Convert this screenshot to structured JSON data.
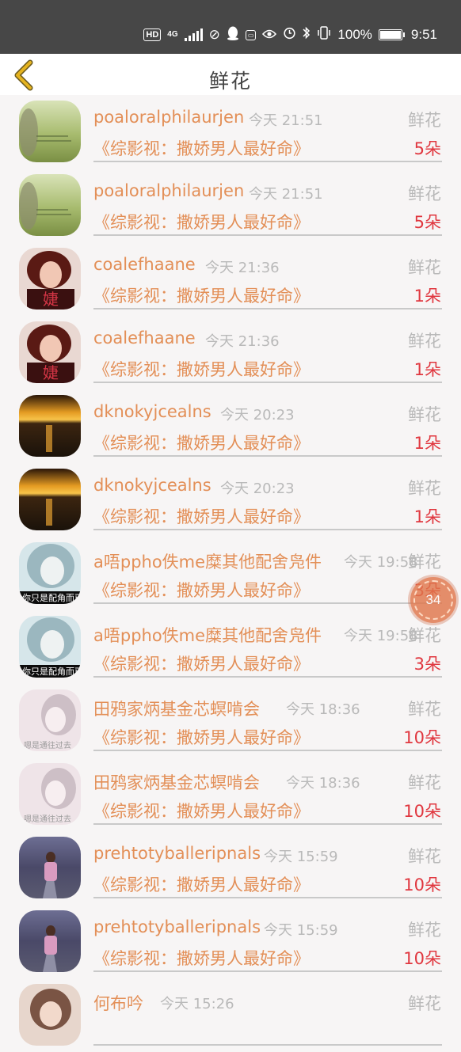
{
  "status_bar": {
    "hd": "HD",
    "network": "4G",
    "battery_pct": "100%",
    "time": "9:51",
    "icons": [
      "hd-icon",
      "signal-icon",
      "no-disturb-icon",
      "qq-icon",
      "huawei-icon",
      "eye-icon",
      "alarm-icon",
      "bluetooth-icon",
      "vibrate-icon",
      "battery-icon"
    ]
  },
  "header": {
    "title": "鲜花",
    "back_icon": "chevron-left-icon"
  },
  "gift_list": [
    {
      "name": "poaloralphilaurjen",
      "time": "今天 21:51",
      "type": "鲜花",
      "book": "《综影视：撒娇男人最好命》",
      "count": "5朵",
      "avatar_theme": "green-field"
    },
    {
      "name": "poaloralphilaurjen",
      "time": "今天 21:51",
      "type": "鲜花",
      "book": "《综影视：撒娇男人最好命》",
      "count": "5朵",
      "avatar_theme": "green-field"
    },
    {
      "name": "coalefhaane",
      "time": "今天 21:36",
      "type": "鲜花",
      "book": "《综影视：撒娇男人最好命》",
      "count": "1朵",
      "avatar_theme": "red-girl"
    },
    {
      "name": "coalefhaane",
      "time": "今天 21:36",
      "type": "鲜花",
      "book": "《综影视：撒娇男人最好命》",
      "count": "1朵",
      "avatar_theme": "red-girl"
    },
    {
      "name": "dknokyjcealns",
      "time": "今天 20:23",
      "type": "鲜花",
      "book": "《综影视：撒娇男人最好命》",
      "count": "1朵",
      "avatar_theme": "sunset-sea"
    },
    {
      "name": "dknokyjcealns",
      "time": "今天 20:23",
      "type": "鲜花",
      "book": "《综影视：撒娇男人最好命》",
      "count": "1朵",
      "avatar_theme": "sunset-sea"
    },
    {
      "name": "a唔ppho佚me糜其他配舍凫件",
      "time": "今天 19:58",
      "type": "鲜花",
      "book": "《综影视：撒娇男人最好命》",
      "count": "3朵",
      "avatar_theme": "blue-girl"
    },
    {
      "name": "a唔ppho佚me糜其他配舍凫件",
      "time": "今天 19:58",
      "type": "鲜花",
      "book": "《综影视：撒娇男人最好命》",
      "count": "3朵",
      "avatar_theme": "blue-girl"
    },
    {
      "name": "田鸦家炳基金芯螟啃会",
      "time": "今天 18:36",
      "type": "鲜花",
      "book": "《综影视：撒娇男人最好命》",
      "count": "10朵",
      "avatar_theme": "pale-girl"
    },
    {
      "name": "田鸦家炳基金芯螟啃会",
      "time": "今天 18:36",
      "type": "鲜花",
      "book": "《综影视：撒娇男人最好命》",
      "count": "10朵",
      "avatar_theme": "pale-girl"
    },
    {
      "name": "prehtotyballeripnals",
      "time": "今天 15:59",
      "type": "鲜花",
      "book": "《综影视：撒娇男人最好命》",
      "count": "10朵",
      "avatar_theme": "road-girl"
    },
    {
      "name": "prehtotyballeripnals",
      "time": "今天 15:59",
      "type": "鲜花",
      "book": "《综影视：撒娇男人最好命》",
      "count": "10朵",
      "avatar_theme": "road-girl"
    },
    {
      "name": "何布吟",
      "time": "今天 15:26",
      "type": "鲜花",
      "book": "",
      "count": "",
      "avatar_theme": "brown-girl"
    }
  ],
  "float_timer": {
    "value": "34"
  },
  "colors": {
    "name": "#e38f57",
    "count": "#e0373f",
    "muted": "#b9b9b9",
    "back_icon": "#e5b31f"
  }
}
